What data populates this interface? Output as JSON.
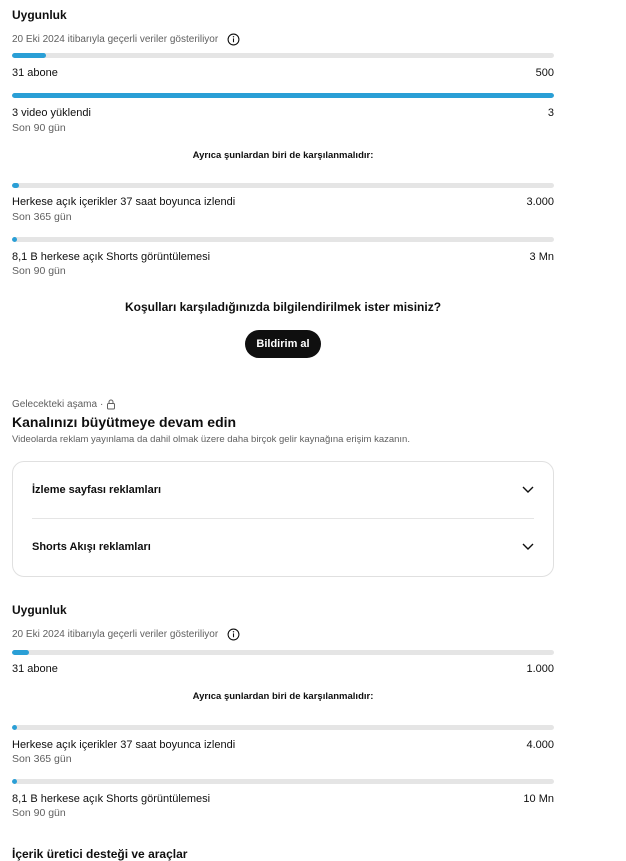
{
  "section1": {
    "title": "Uygunluk",
    "data_note": "20 Eki 2024 itibarıyla geçerli veriler gösteriliyor",
    "subscribers": {
      "label": "31 abone",
      "target": "500",
      "progress": 0.062
    },
    "uploads": {
      "label": "3 video yüklendi",
      "sub": "Son 90 gün",
      "target": "3",
      "progress": 1.0
    },
    "also_required": "Ayrıca şunlardan biri de karşılanmalıdır:",
    "watch_hours": {
      "label": "Herkese açık içerikler 37 saat boyunca izlendi",
      "sub": "Son 365 gün",
      "target": "3.000",
      "progress": 0.012
    },
    "shorts_views": {
      "label": "8,1 B herkese açık Shorts görüntülemesi",
      "sub": "Son 90 gün",
      "target": "3 Mn",
      "progress": 0.003
    },
    "notify_question": "Koşulları karşıladığınızda bilgilendirilmek ister misiniz?",
    "notify_button": "Bildirim al"
  },
  "future": {
    "stage_label": "Gelecekteki aşama",
    "title": "Kanalınızı büyütmeye devam edin",
    "description": "Videolarda reklam yayınlama da dahil olmak üzere daha birçok gelir kaynağına erişim kazanın.",
    "items": [
      {
        "label": "İzleme sayfası reklamları"
      },
      {
        "label": "Shorts Akışı reklamları"
      }
    ]
  },
  "section2": {
    "title": "Uygunluk",
    "data_note": "20 Eki 2024 itibarıyla geçerli veriler gösteriliyor",
    "subscribers": {
      "label": "31 abone",
      "target": "1.000",
      "progress": 0.031
    },
    "also_required": "Ayrıca şunlardan biri de karşılanmalıdır:",
    "watch_hours": {
      "label": "Herkese açık içerikler 37 saat boyunca izlendi",
      "sub": "Son 365 gün",
      "target": "4.000",
      "progress": 0.009
    },
    "shorts_views": {
      "label": "8,1 B herkese açık Shorts görüntülemesi",
      "sub": "Son 90 gün",
      "target": "10 Mn",
      "progress": 0.001
    }
  },
  "next_section_title": "İçerik üretici desteği ve araçlar",
  "colors": {
    "progress": "#2a9fd6",
    "track": "#e5e5e5"
  }
}
